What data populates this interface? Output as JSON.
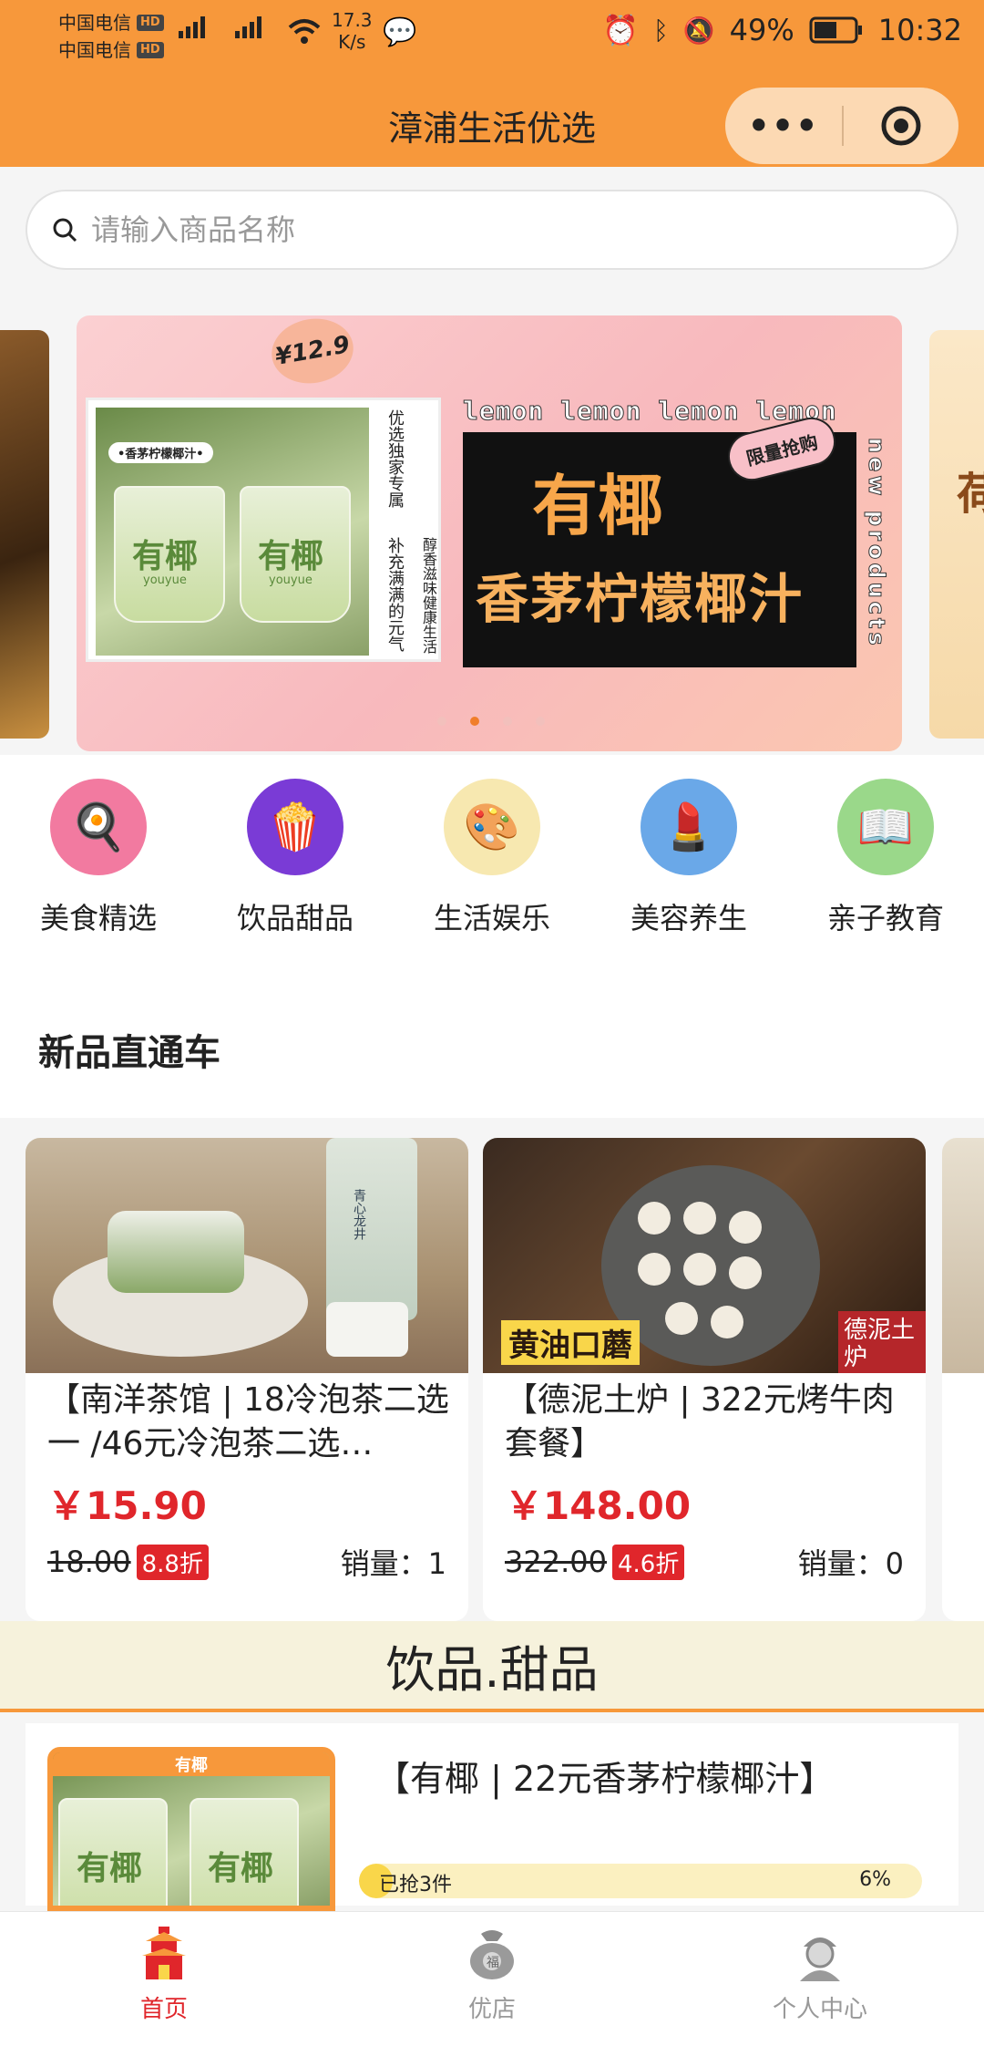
{
  "status_bar": {
    "carrier1": "中国电信",
    "carrier2": "中国电信",
    "hd": "HD",
    "net": "46",
    "speed_value": "17.3",
    "speed_unit": "K/s",
    "battery": "49%",
    "time": "10:32"
  },
  "header": {
    "title": "漳浦生活优选",
    "more_icon": "more-dots-icon",
    "target_icon": "target-icon"
  },
  "search": {
    "placeholder": "请输入商品名称",
    "icon": "search-icon"
  },
  "banner": {
    "tag": "•香茅柠檬椰汁•",
    "price": "¥12.9",
    "col1": "优选独家专属",
    "col2": "补充满满的元气",
    "col3": "醇香滋味健康生活",
    "lemon_line": "lemon lemon lemon lemon",
    "brand_cup": "有椰",
    "brand_cup_sub": "youyue",
    "headline1": "有椰",
    "headline2": "香茅柠檬椰汁",
    "limited": "限量抢购",
    "new_products": "new products",
    "next_peek": "荷",
    "active_dot": 1,
    "dot_count": 4
  },
  "categories": [
    {
      "label": "美食精选",
      "icon": "food-icon",
      "glyph": "🍳",
      "color": "#f27aa0"
    },
    {
      "label": "饮品甜品",
      "icon": "drink-icon",
      "glyph": "🍿",
      "color": "#7a3bd6"
    },
    {
      "label": "生活娱乐",
      "icon": "entertainment-icon",
      "glyph": "🎨",
      "color": "#f7e8b0"
    },
    {
      "label": "美容养生",
      "icon": "beauty-icon",
      "glyph": "💄",
      "color": "#6aa8e8"
    },
    {
      "label": "亲子教育",
      "icon": "education-icon",
      "glyph": "📖",
      "color": "#9ad88a"
    }
  ],
  "new_section": {
    "title": "新品直通车"
  },
  "products": [
    {
      "name": "【南洋茶馆 | 18冷泡茶二选一 /46元冷泡茶二选…",
      "price": "￥15.90",
      "old_price": "18.00",
      "discount": "8.8折",
      "sold": "销量：1",
      "bottle_label": "青心龙井"
    },
    {
      "name": "【德泥土炉 | 322元烤牛肉套餐】",
      "price": "￥148.00",
      "old_price": "322.00",
      "discount": "4.6折",
      "sold": "销量：0",
      "img_text1": "黄油口蘑",
      "img_text2": "德泥土炉"
    }
  ],
  "drinks_section": {
    "title": "饮品.甜品",
    "item": {
      "thumb_tag": "有椰",
      "name": "【有椰 | 22元香茅柠檬椰汁】",
      "grabbed": "已抢3件",
      "percent_label": "6%",
      "progress": 0.06
    }
  },
  "tabbar": [
    {
      "label": "首页",
      "icon": "home-pagoda-icon",
      "active": true
    },
    {
      "label": "优店",
      "icon": "lucky-bag-icon",
      "active": false
    },
    {
      "label": "个人中心",
      "icon": "user-avatar-icon",
      "active": false
    }
  ],
  "colors": {
    "brand": "#f7983b",
    "price_red": "#e0262b"
  }
}
